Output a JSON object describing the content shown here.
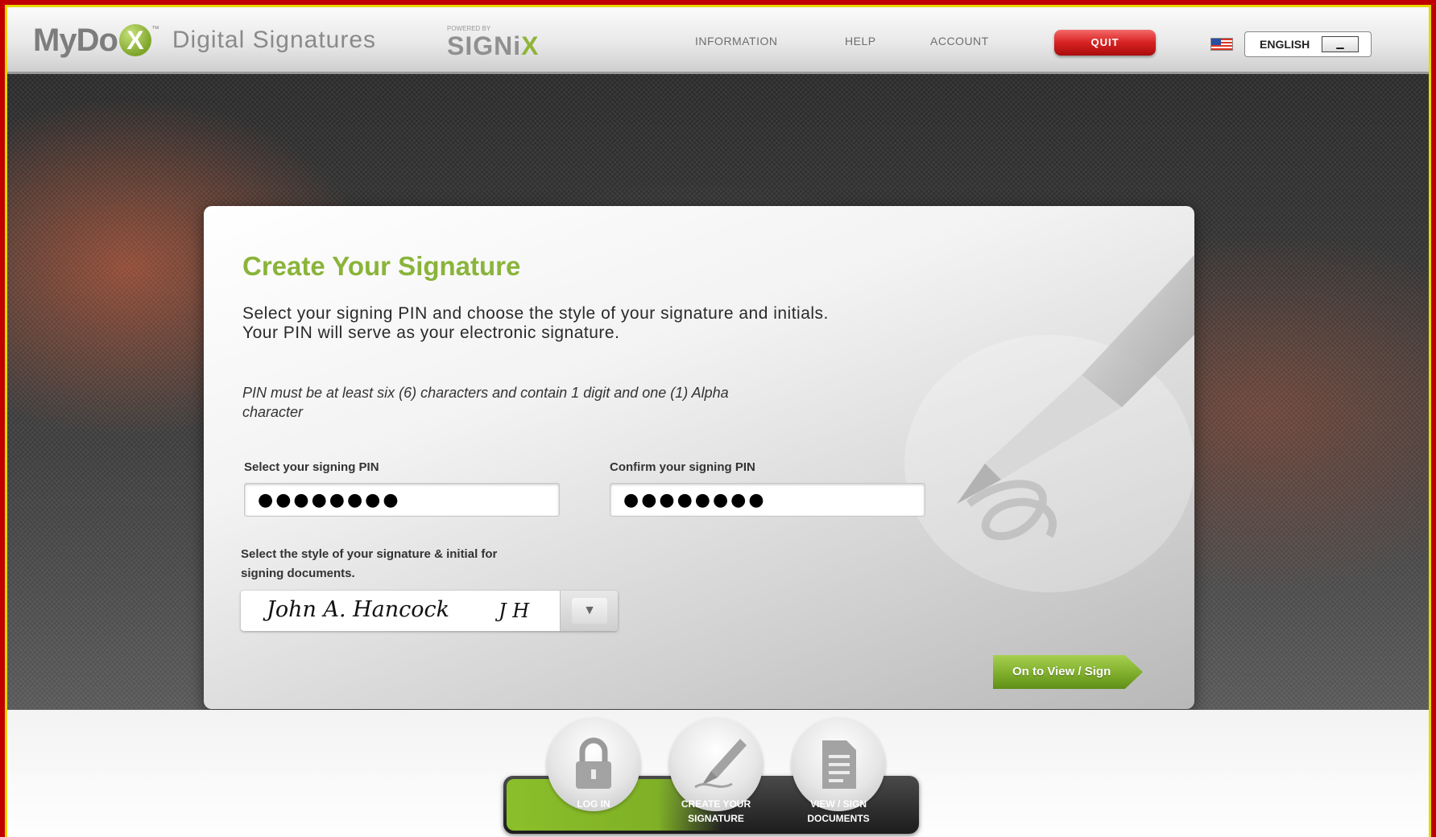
{
  "header": {
    "logo": {
      "mydo": "MyDo",
      "x": "X",
      "tm": "™",
      "product": "Digital Signatures"
    },
    "signix": {
      "powered_by": "POWERED BY",
      "word": "SIGNi",
      "x": "X"
    },
    "nav": [
      "INFORMATION",
      "HELP",
      "ACCOUNT"
    ],
    "quit_label": "QUIT",
    "language": "ENGLISH"
  },
  "card": {
    "title": "Create Your Signature",
    "intro_line1": "Select your signing PIN and choose the style of your signature and initials.",
    "intro_line2": "Your PIN will serve as your electronic signature.",
    "rule_line1": "PIN must be at least six (6) characters and contain 1 digit and one (1) Alpha",
    "rule_line2": "character",
    "pin_label": "Select your signing PIN",
    "pin_value": "●●●●●●●●",
    "confirm_label": "Confirm your signing PIN",
    "confirm_value": "●●●●●●●●",
    "style_label_line1": "Select the style of your signature & initial for",
    "style_label_line2": "signing documents.",
    "signature_full": "John A. Hancock",
    "signature_initials": "J H",
    "next_button": "On to View / Sign"
  },
  "steps": [
    {
      "label": "LOG IN",
      "icon": "lock-icon"
    },
    {
      "label": "CREATE YOUR\nSIGNATURE",
      "icon": "pen-icon"
    },
    {
      "label": "VIEW / SIGN\nDOCUMENTS",
      "icon": "document-icon"
    }
  ],
  "colors": {
    "accent_green": "#8ab43a",
    "quit_red": "#d82222",
    "border_yellow": "#e6d800",
    "outer_red": "#c00000"
  }
}
